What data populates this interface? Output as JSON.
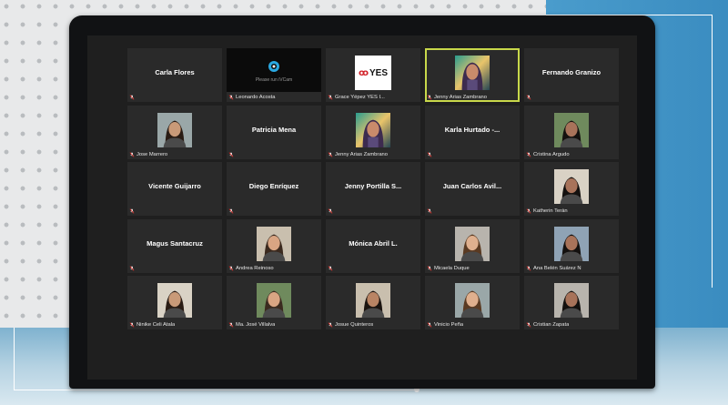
{
  "meeting": {
    "participants": [
      {
        "id": "p1",
        "display": "name",
        "name": "Carla Flores",
        "label": ""
      },
      {
        "id": "p2",
        "display": "logo-ivcam",
        "name": "",
        "label": "Leonardo Acosta",
        "logo_text": "Please run iVCam"
      },
      {
        "id": "p3",
        "display": "logo-yes",
        "name": "",
        "label": "Grace Yépez YES I...",
        "logo_text": "YES"
      },
      {
        "id": "p4",
        "display": "photo",
        "name": "",
        "label": "Jenny Arias Zambrano",
        "active": true
      },
      {
        "id": "p5",
        "display": "name",
        "name": "Fernando Granizo",
        "label": ""
      },
      {
        "id": "p6",
        "display": "photo",
        "name": "",
        "label": "Jose Marrero"
      },
      {
        "id": "p7",
        "display": "name",
        "name": "Patricia Mena",
        "label": ""
      },
      {
        "id": "p8",
        "display": "photo",
        "name": "",
        "label": "Jenny Arias Zambrano"
      },
      {
        "id": "p9",
        "display": "name",
        "name": "Karla  Hurtado  -...",
        "label": ""
      },
      {
        "id": "p10",
        "display": "photo",
        "name": "",
        "label": "Cristina Argudo"
      },
      {
        "id": "p11",
        "display": "name",
        "name": "Vicente Guijarro",
        "label": ""
      },
      {
        "id": "p12",
        "display": "name",
        "name": "Diego Enríquez",
        "label": ""
      },
      {
        "id": "p13",
        "display": "name",
        "name": "Jenny  Portilla  S...",
        "label": ""
      },
      {
        "id": "p14",
        "display": "name",
        "name": "Juan Carlos Avil...",
        "label": ""
      },
      {
        "id": "p15",
        "display": "photo",
        "name": "",
        "label": "Katherin Terán"
      },
      {
        "id": "p16",
        "display": "name",
        "name": "Magus Santacruz",
        "label": ""
      },
      {
        "id": "p17",
        "display": "photo",
        "name": "",
        "label": "Andrea Reinoso"
      },
      {
        "id": "p18",
        "display": "name",
        "name": "Mónica Abril L.",
        "label": ""
      },
      {
        "id": "p19",
        "display": "photo",
        "name": "",
        "label": "Micaela Duque"
      },
      {
        "id": "p20",
        "display": "photo",
        "name": "",
        "label": "Ana Belén Suárez N"
      },
      {
        "id": "p21",
        "display": "photo",
        "name": "",
        "label": "Ninike Celi Atala"
      },
      {
        "id": "p22",
        "display": "photo",
        "name": "",
        "label": "Ma. José Villalva"
      },
      {
        "id": "p23",
        "display": "photo",
        "name": "",
        "label": "Josue Quinteros"
      },
      {
        "id": "p24",
        "display": "photo",
        "name": "",
        "label": "Vinicio Peña"
      },
      {
        "id": "p25",
        "display": "photo",
        "name": "",
        "label": "Cristian Zapata"
      }
    ]
  },
  "colors": {
    "tile_bg": "#2a2a2a",
    "screen_bg": "#1f1f1f",
    "active_speaker_border": "#c8d84a",
    "muted_mic": "#e0302a"
  },
  "icons": {
    "muted": "microphone-muted-icon"
  }
}
